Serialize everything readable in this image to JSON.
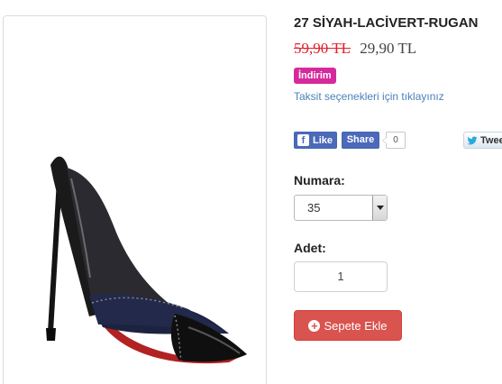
{
  "product": {
    "title": "27 SİYAH-LACİVERT-RUGAN",
    "old_price": "59,90 TL",
    "new_price": "29,90 TL",
    "badge": "İndirim",
    "installment_link": "Taksit seçenekleri için tıklayınız"
  },
  "social": {
    "fb_like_label": "Like",
    "fb_like_icon": "f",
    "fb_share_label": "Share",
    "share_count": "0",
    "tweet_label": "Tweet"
  },
  "options": {
    "size_label": "Numara:",
    "size_selected": "35",
    "qty_label": "Adet:",
    "qty_value": "1"
  },
  "cart": {
    "add_label": "Sepete Ekle",
    "plus_icon": "+"
  },
  "colors": {
    "discount_badge": "#d62a9c",
    "old_price": "#e0202a",
    "link": "#4a82b9",
    "add_button": "#d9534f",
    "facebook": "#4c69ba"
  },
  "icons": [
    "facebook-icon",
    "twitter-bird-icon",
    "plus-circle-icon",
    "chevron-down-icon"
  ]
}
